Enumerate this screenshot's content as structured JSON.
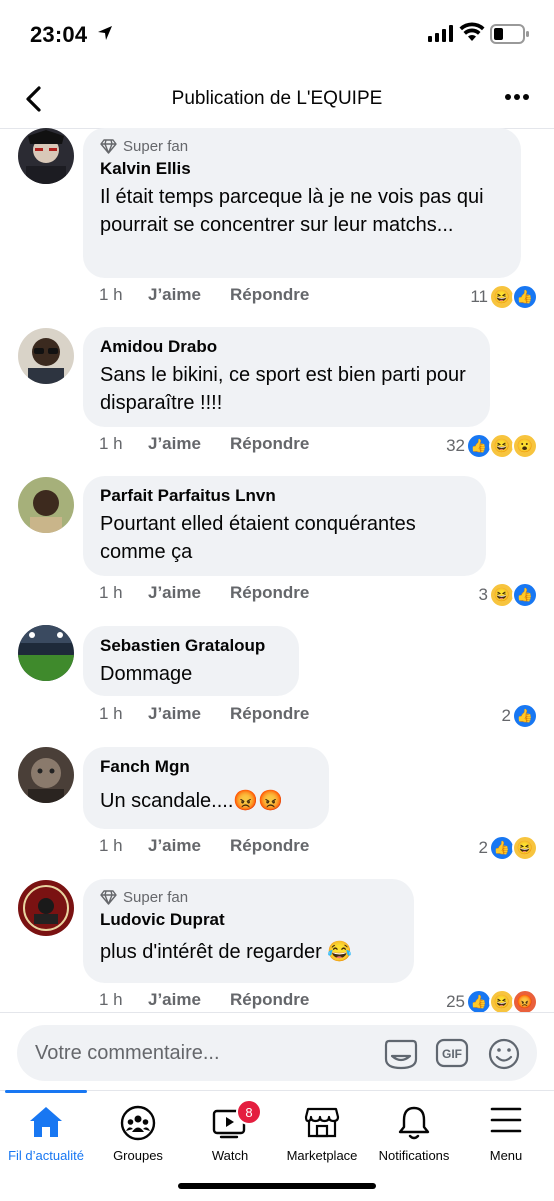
{
  "status_bar": {
    "time": "23:04"
  },
  "header": {
    "title": "Publication de L'EQUIPE"
  },
  "comments": [
    {
      "badge": "Super fan",
      "author": "Kalvin Ellis",
      "text": "Il était temps parceque là je ne vois pas qui pourrait se concentrer sur leur matchs...",
      "time": "1 h",
      "like": "J’aime",
      "reply": "Répondre",
      "count": "11",
      "reactions": [
        "haha",
        "like"
      ]
    },
    {
      "badge": "",
      "author": "Amidou Drabo",
      "text": "Sans le bikini, ce sport est bien parti pour disparaître !!!!",
      "time": "1 h",
      "like": "J’aime",
      "reply": "Répondre",
      "count": "32",
      "reactions": [
        "like",
        "haha",
        "wow"
      ]
    },
    {
      "badge": "",
      "author": "Parfait Parfaitus Lnvn",
      "text": "Pourtant elled étaient conquérantes comme ça",
      "time": "1 h",
      "like": "J’aime",
      "reply": "Répondre",
      "count": "3",
      "reactions": [
        "haha",
        "like"
      ]
    },
    {
      "badge": "",
      "author": "Sebastien Grataloup",
      "text": "Dommage",
      "time": "1 h",
      "like": "J’aime",
      "reply": "Répondre",
      "count": "2",
      "reactions": [
        "like"
      ]
    },
    {
      "badge": "",
      "author": "Fanch Mgn",
      "text": "Un scandale....😡😡",
      "time": "1 h",
      "like": "J’aime",
      "reply": "Répondre",
      "count": "2",
      "reactions": [
        "like",
        "haha"
      ]
    },
    {
      "badge": "Super fan",
      "author": "Ludovic Duprat",
      "text": "plus d'intérêt de regarder 😂",
      "time": "1 h",
      "like": "J’aime",
      "reply": "Répondre",
      "count": "25",
      "reactions": [
        "like",
        "haha",
        "angry"
      ]
    }
  ],
  "composer": {
    "placeholder": "Votre commentaire...",
    "gif_label": "GIF"
  },
  "tabbar": {
    "items": [
      {
        "label": "Fil d’actualité",
        "icon": "home-icon"
      },
      {
        "label": "Groupes",
        "icon": "groups-icon"
      },
      {
        "label": "Watch",
        "icon": "watch-icon",
        "badge": "8"
      },
      {
        "label": "Marketplace",
        "icon": "marketplace-icon"
      },
      {
        "label": "Notifications",
        "icon": "bell-icon"
      },
      {
        "label": "Menu",
        "icon": "menu-icon"
      }
    ]
  },
  "colors": {
    "accent": "#1877f2",
    "bubble": "#f0f2f5",
    "muted": "#65676b",
    "badge_red": "#e41e3f"
  }
}
